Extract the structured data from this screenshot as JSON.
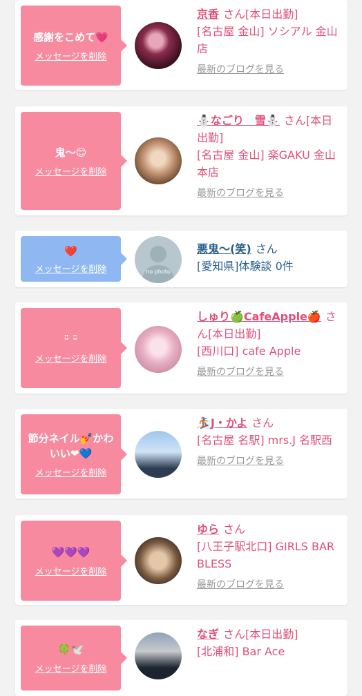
{
  "cards": [
    {
      "message": "感謝をこめて💗",
      "delete_label": "メッセージを削除",
      "name": "京香",
      "san": "さん",
      "status": "[本日出勤]",
      "shop": "[名古屋 金山] ソシアル 金山店",
      "blog_link": "最新のブログを見る"
    },
    {
      "message": "鬼〜😊",
      "delete_label": "メッセージを削除",
      "name": "⛄なごり　雪⛄",
      "san": "さん",
      "status": "[本日出勤]",
      "shop": "[名古屋 金山] 楽GAKU 金山本店",
      "blog_link": "最新のブログを見る"
    },
    {
      "message": "❤️",
      "delete_label": "メッセージを削除",
      "name": "悪鬼〜(笑)",
      "san": "さん",
      "shop": "[愛知県]体験談 0件",
      "avatar_text": "no photo"
    },
    {
      "message": "ᵕ̈ ᵕ̈",
      "delete_label": "メッセージを削除",
      "name": "しゅり🍏CafeApple🍎",
      "san": "さん",
      "status": "[本日出勤]",
      "shop": "[西川口] cafe Apple",
      "blog_link": "最新のブログを見る"
    },
    {
      "message": "節分ネイル💅かわいい❤💙",
      "delete_label": "メッセージを削除",
      "name": "🏂J・かよ",
      "san": "さん",
      "shop": "[名古屋 名駅] mrs.J 名駅西",
      "blog_link": "最新のブログを見る"
    },
    {
      "message": "💜💜💜",
      "delete_label": "メッセージを削除",
      "name": "ゆら",
      "san": "さん",
      "shop": "[八王子駅北口] GIRLS BAR BLESS",
      "blog_link": "最新のブログを見る"
    },
    {
      "message": "🍀🕊️",
      "delete_label": "メッセージを削除",
      "name": "なぎ",
      "san": "さん",
      "status": "[本日出勤]",
      "shop": "[北浦和] Bar Ace"
    }
  ],
  "colors": {
    "accent_pink": "#e05078",
    "bubble_pink": "#f78a9f",
    "bubble_blue": "#8fb8f2",
    "link_blue": "#2a5f8c",
    "muted_gray": "#999999"
  }
}
